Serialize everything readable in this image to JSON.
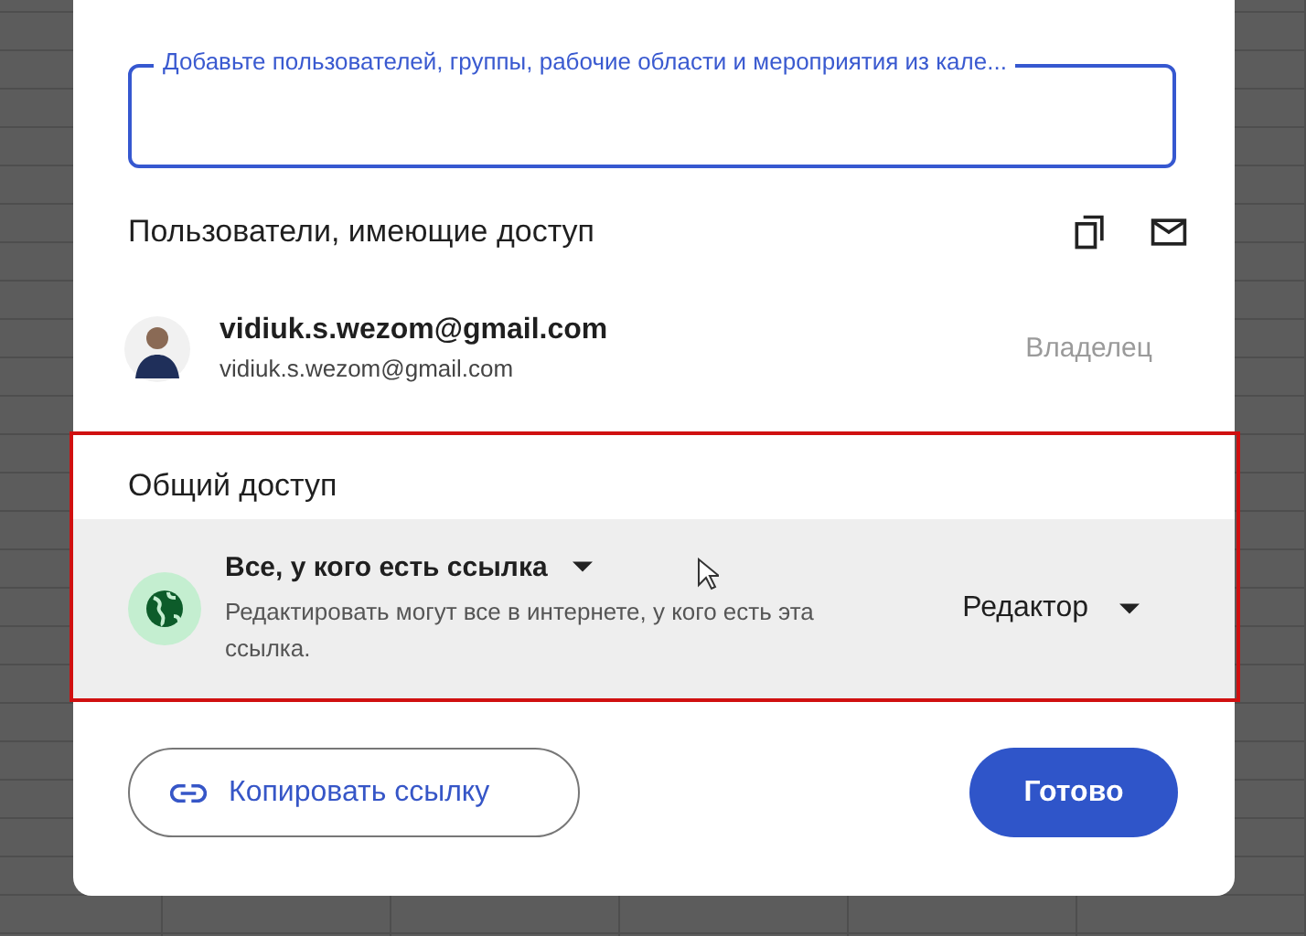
{
  "add_people_field": {
    "label": "Добавьте пользователей, группы, рабочие области и мероприятия из кале..."
  },
  "people_section": {
    "title": "Пользователи, имеющие доступ"
  },
  "people": [
    {
      "name": "vidiuk.s.wezom@gmail.com",
      "email": "vidiuk.s.wezom@gmail.com",
      "role": "Владелец"
    }
  ],
  "general_access": {
    "title": "Общий доступ",
    "scope": "Все, у кого есть ссылка",
    "description": "Редактировать могут все в интернете, у кого есть эта ссылка.",
    "role": "Редактор"
  },
  "buttons": {
    "copy_link": "Копировать ссылку",
    "done": "Готово"
  }
}
